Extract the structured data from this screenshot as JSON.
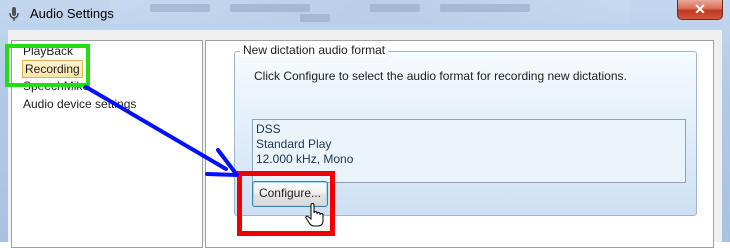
{
  "window": {
    "title": "Audio Settings",
    "close_glyph": "✕",
    "icon": "microphone-icon"
  },
  "nav": {
    "items": [
      {
        "label": "PlayBack"
      },
      {
        "label": "Recording",
        "selected": true
      },
      {
        "label": "SpeechMike"
      },
      {
        "label": "Audio device settings"
      }
    ]
  },
  "content": {
    "group_title": "New dictation audio format",
    "hint": "Click Configure to select the audio format for recording new dictations.",
    "format": {
      "line1": "DSS",
      "line2": "Standard Play",
      "line3": "12.000 kHz, Mono"
    },
    "configure_label": "Configure..."
  },
  "annotations": {
    "highlight_color": "#22dd11",
    "target_color": "#f00000",
    "arrow_color": "#0010ff"
  }
}
